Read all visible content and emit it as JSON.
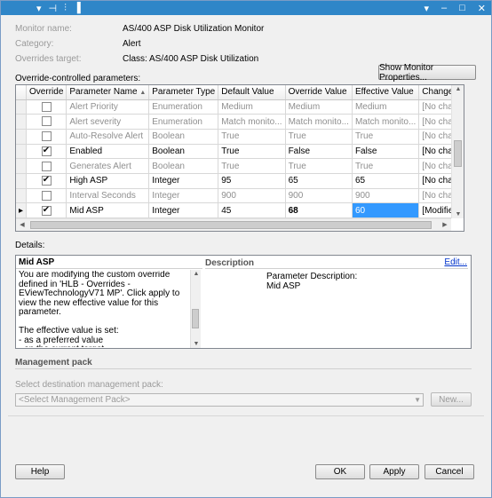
{
  "titlebar": {
    "left_icons": [
      "▾",
      "⊣",
      "⫶",
      "▐"
    ],
    "right_icons": [
      "▾",
      "–",
      "□",
      "✕"
    ]
  },
  "info": {
    "monitor_name_label": "Monitor name:",
    "monitor_name_value": "AS/400 ASP Disk Utilization Monitor",
    "category_label": "Category:",
    "category_value": "Alert",
    "overrides_target_label": "Overrides target:",
    "overrides_target_value": "Class: AS/400 ASP Disk Utilization"
  },
  "show_monitor_properties_button": "Show Monitor Properties...",
  "override_params_label": "Override-controlled parameters:",
  "table": {
    "columns": [
      "Override",
      "Parameter Name",
      "Parameter Type",
      "Default Value",
      "Override Value",
      "Effective Value",
      "Change Status"
    ],
    "rows": [
      {
        "override": false,
        "name": "Alert Priority",
        "type": "Enumeration",
        "default": "Medium",
        "override_value": "Medium",
        "effective": "Medium",
        "status": "[No change]",
        "disabled": true
      },
      {
        "override": false,
        "name": "Alert severity",
        "type": "Enumeration",
        "default": "Match monito...",
        "override_value": "Match monito...",
        "effective": "Match monito...",
        "status": "[No change]",
        "disabled": true
      },
      {
        "override": false,
        "name": "Auto-Resolve Alert",
        "type": "Boolean",
        "default": "True",
        "override_value": "True",
        "effective": "True",
        "status": "[No change]",
        "disabled": true
      },
      {
        "override": true,
        "name": "Enabled",
        "type": "Boolean",
        "default": "True",
        "override_value": "False",
        "effective": "False",
        "status": "[No change]",
        "disabled": false
      },
      {
        "override": false,
        "name": "Generates Alert",
        "type": "Boolean",
        "default": "True",
        "override_value": "True",
        "effective": "True",
        "status": "[No change]",
        "disabled": true
      },
      {
        "override": true,
        "name": "High ASP",
        "type": "Integer",
        "default": "95",
        "override_value": "65",
        "effective": "65",
        "status": "[No change]",
        "disabled": false
      },
      {
        "override": false,
        "name": "Interval Seconds",
        "type": "Integer",
        "default": "900",
        "override_value": "900",
        "effective": "900",
        "status": "[No change]",
        "disabled": true
      },
      {
        "override": true,
        "name": "Mid ASP",
        "type": "Integer",
        "default": "45",
        "override_value": "68",
        "effective": "60",
        "status": "[Modified]",
        "disabled": false,
        "current": true
      }
    ],
    "current_row_marker": "▸"
  },
  "details": {
    "label": "Details:",
    "title": "Mid ASP",
    "text": "You are modifying the custom override defined in 'HLB - Overrides - EViewTechnologyV71 MP'. Click apply to view the new effective value for this parameter.\n\nThe effective value is set:\n - as a preferred value\n - on the current target\n - by the custom override in 'HLB - Overrides",
    "description_header": "Description",
    "edit_link": "Edit...",
    "description_title": "Parameter Description:",
    "description_value": "Mid ASP"
  },
  "management_pack": {
    "header": "Management pack",
    "select_label": "Select destination management pack:",
    "select_value": "<Select Management Pack>",
    "new_button": "New..."
  },
  "footer": {
    "help_button": "Help",
    "ok_button": "OK",
    "apply_button": "Apply",
    "cancel_button": "Cancel"
  }
}
